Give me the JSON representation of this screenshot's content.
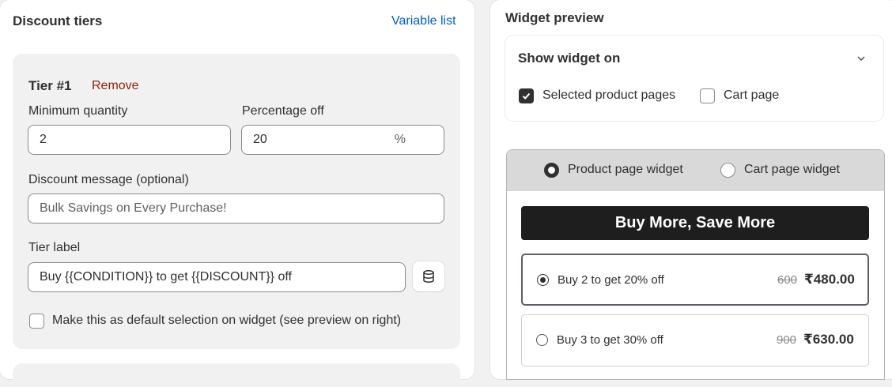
{
  "discount_tiers": {
    "title": "Discount tiers",
    "variable_list_link": "Variable list",
    "tier": {
      "title": "Tier #1",
      "remove_label": "Remove",
      "min_qty_label": "Minimum quantity",
      "min_qty_value": "2",
      "pct_off_label": "Percentage off",
      "pct_off_value": "20",
      "pct_suffix": "%",
      "message_label": "Discount message (optional)",
      "message_placeholder": "Bulk Savings on Every Purchase!",
      "tier_label_label": "Tier label",
      "tier_label_value": "Buy {{CONDITION}} to get {{DISCOUNT}} off",
      "variables_icon": "database-icon",
      "default_selection_label": "Make this as default selection on widget (see preview on right)",
      "default_selection_checked": false
    }
  },
  "widget_preview": {
    "title": "Widget preview",
    "show_widget_on": {
      "label": "Show widget on",
      "options": [
        {
          "label": "Selected product pages",
          "checked": true
        },
        {
          "label": "Cart page",
          "checked": false
        }
      ]
    },
    "tabs": [
      {
        "label": "Product page widget",
        "selected": true
      },
      {
        "label": "Cart page widget",
        "selected": false
      }
    ],
    "banner": "Buy More, Save More",
    "tiers": [
      {
        "label": "Buy 2 to get 20% off",
        "old_price": "600",
        "price": "₹480.00",
        "selected": true
      },
      {
        "label": "Buy 3 to get 30% off",
        "old_price": "900",
        "price": "₹630.00",
        "selected": false
      }
    ]
  },
  "colors": {
    "link": "#005bd3",
    "remove": "#8e1f0b",
    "banner_bg": "#1e1e1e",
    "tabs_bg": "#d9d9d9"
  }
}
